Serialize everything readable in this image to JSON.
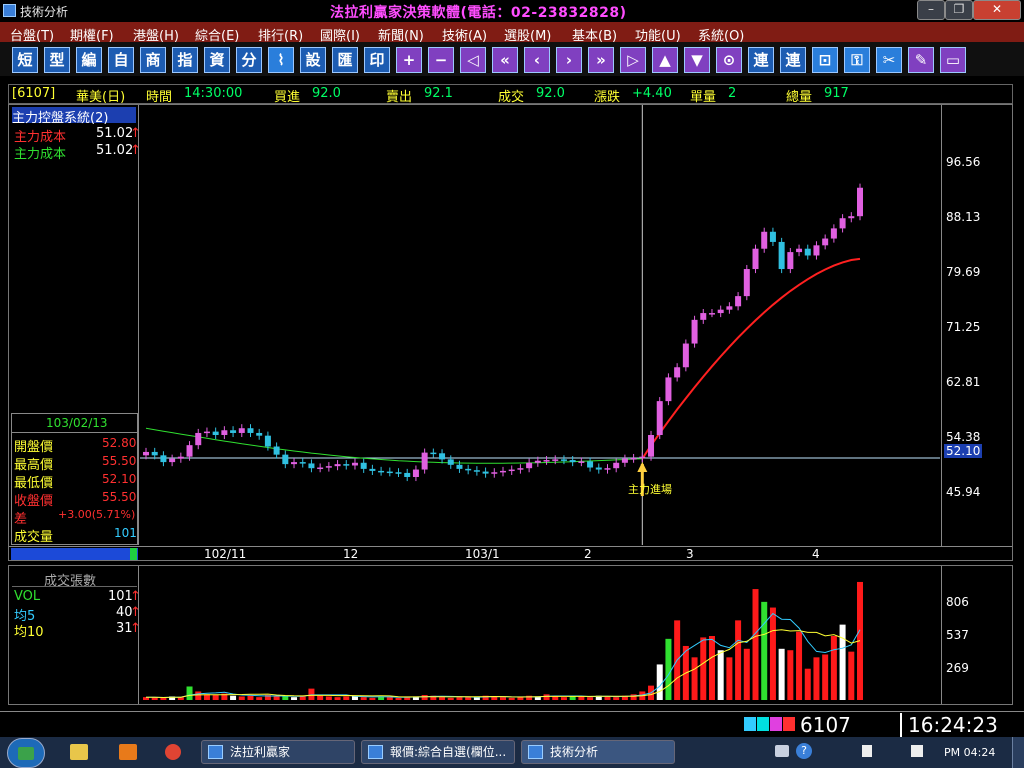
{
  "window": {
    "title": "技術分析",
    "hotline": "法拉利贏家決策軟體(電話：02-23832828)",
    "minimize": "–",
    "restore": "❐",
    "close": "✕"
  },
  "menu": [
    {
      "label": "台盤(T)"
    },
    {
      "label": "期權(F)"
    },
    {
      "label": "港盤(H)"
    },
    {
      "label": "綜合(E)"
    },
    {
      "label": "排行(R)"
    },
    {
      "label": "國際(I)"
    },
    {
      "label": "新聞(N)"
    },
    {
      "label": "技術(A)"
    },
    {
      "label": "選股(M)"
    },
    {
      "label": "基本(B)"
    },
    {
      "label": "功能(U)"
    },
    {
      "label": "系統(O)"
    }
  ],
  "toolbar": [
    {
      "label": "短",
      "icon": "short-term"
    },
    {
      "label": "型",
      "icon": "pattern"
    },
    {
      "label": "編",
      "icon": "edit"
    },
    {
      "label": "自",
      "icon": "custom"
    },
    {
      "label": "商",
      "icon": "commodity"
    },
    {
      "label": "指",
      "icon": "index"
    },
    {
      "label": "資",
      "icon": "data"
    },
    {
      "label": "分",
      "icon": "minute"
    },
    {
      "label": "⌇",
      "icon": "chart-icon"
    },
    {
      "label": "設",
      "icon": "settings"
    },
    {
      "label": "匯",
      "icon": "export"
    },
    {
      "label": "印",
      "icon": "print"
    },
    {
      "label": "+",
      "icon": "zoom-in-icon"
    },
    {
      "label": "−",
      "icon": "zoom-out-icon"
    },
    {
      "label": "◁",
      "icon": "first-icon"
    },
    {
      "label": "«",
      "icon": "rewind-icon"
    },
    {
      "label": "‹",
      "icon": "prev-icon"
    },
    {
      "label": "›",
      "icon": "next-icon"
    },
    {
      "label": "»",
      "icon": "forward-icon"
    },
    {
      "label": "▷",
      "icon": "last-icon"
    },
    {
      "label": "▲",
      "icon": "up-icon"
    },
    {
      "label": "▼",
      "icon": "down-icon"
    },
    {
      "label": "⊙",
      "icon": "esc-icon"
    },
    {
      "label": "連",
      "icon": "link"
    },
    {
      "label": "連",
      "icon": "link-2"
    },
    {
      "label": "⊡",
      "icon": "window-icon"
    },
    {
      "label": "⚿",
      "icon": "lock-icon"
    },
    {
      "label": "✂",
      "icon": "tools-icon"
    },
    {
      "label": "✎",
      "icon": "note-icon"
    },
    {
      "label": "▭",
      "icon": "screen-icon"
    }
  ],
  "quote": {
    "code": "[6107]",
    "name": "華美(日)",
    "time_label": "時間",
    "time": "14:30:00",
    "bid_label": "買進",
    "bid": "92.0",
    "ask_label": "賣出",
    "ask": "92.1",
    "last_label": "成交",
    "last": "92.0",
    "change_label": "漲跌",
    "change": "+4.40",
    "unit_label": "單量",
    "unit": "2",
    "total_label": "總量",
    "total": "917"
  },
  "indicator": {
    "name": "主力控盤系統(2)",
    "rows": [
      {
        "label": "主力成本",
        "value": "51.02",
        "arrow": "↑",
        "color": "#ff3030"
      },
      {
        "label": "主力成本",
        "value": "51.02",
        "arrow": "↑",
        "color": "#30e030"
      }
    ]
  },
  "ohlc": {
    "date": "103/02/13",
    "rows": [
      {
        "label": "開盤價",
        "value": "52.80"
      },
      {
        "label": "最高價",
        "value": "55.50"
      },
      {
        "label": "最低價",
        "value": "52.10"
      },
      {
        "label": "收盤價",
        "value": "55.50"
      },
      {
        "label": "差",
        "value": "+3.00(5.71%)"
      },
      {
        "label": "成交量",
        "value": "101"
      }
    ]
  },
  "price_axis": [
    "96.56",
    "88.13",
    "79.69",
    "71.25",
    "62.81",
    "54.38",
    "45.94"
  ],
  "price_current": "52.10",
  "date_axis": [
    "102/11",
    "12",
    "103/1",
    "2",
    "3",
    "4"
  ],
  "annotation": "主力進場",
  "volume": {
    "title": "成交張數",
    "rows": [
      {
        "label": "VOL",
        "value": "101",
        "arrow": "↑",
        "color": "#30e030"
      },
      {
        "label": "均5",
        "value": "40",
        "arrow": "↑",
        "color": "#33ccff"
      },
      {
        "label": "均10",
        "value": "31",
        "arrow": "↑",
        "color": "#ffff33"
      }
    ],
    "axis": [
      "806",
      "537",
      "269"
    ]
  },
  "chart_data": {
    "type": "candlestick",
    "ylim": [
      40,
      102
    ],
    "x_ticks": [
      "102/11",
      "12",
      "103/1",
      "2",
      "3",
      "4"
    ],
    "y_ticks": [
      96.56,
      88.13,
      79.69,
      71.25,
      62.81,
      54.38,
      45.94
    ],
    "current_price": 52.1,
    "series": [
      {
        "name": "主力成本",
        "values_start": 56.0,
        "values_end": 81.5
      },
      {
        "name": "主力成本",
        "values_start": 56.5,
        "values_end": 52.0
      }
    ],
    "closes": [
      53.0,
      52.5,
      51.5,
      52.0,
      52.3,
      54.0,
      55.8,
      56.0,
      55.5,
      56.2,
      55.8,
      56.5,
      55.8,
      55.4,
      53.8,
      52.6,
      51.2,
      51.5,
      51.3,
      50.6,
      50.7,
      50.9,
      51.2,
      51.0,
      51.4,
      50.5,
      50.2,
      50.1,
      50.0,
      49.9,
      49.3,
      50.4,
      52.9,
      52.8,
      51.9,
      51.1,
      50.5,
      50.3,
      50.1,
      49.8,
      50.0,
      50.2,
      50.4,
      50.6,
      51.4,
      51.7,
      51.8,
      51.9,
      51.8,
      51.5,
      51.6,
      50.7,
      50.4,
      50.6,
      51.4,
      52.0,
      52.1,
      52.3,
      55.5,
      60.5,
      64.0,
      65.5,
      69.0,
      72.5,
      73.5,
      73.5,
      74.0,
      74.5,
      76.0,
      80.0,
      83.0,
      85.5,
      84.0,
      80.0,
      82.5,
      83.0,
      82.0,
      83.5,
      84.5,
      86.0,
      87.5,
      87.8,
      92.0
    ],
    "volumes": [
      20,
      18,
      15,
      25,
      20,
      95,
      60,
      40,
      35,
      45,
      30,
      25,
      30,
      20,
      35,
      30,
      25,
      20,
      25,
      80,
      30,
      25,
      20,
      25,
      30,
      20,
      15,
      25,
      20,
      15,
      20,
      25,
      35,
      30,
      20,
      15,
      20,
      25,
      20,
      30,
      25,
      20,
      15,
      20,
      30,
      25,
      40,
      25,
      20,
      30,
      25,
      20,
      30,
      25,
      20,
      30,
      40,
      60,
      101,
      250,
      430,
      560,
      380,
      300,
      440,
      450,
      350,
      300,
      560,
      360,
      780,
      690,
      650,
      360,
      350,
      480,
      220,
      300,
      320,
      450,
      530,
      340,
      830
    ]
  },
  "status": {
    "code": "6107",
    "time": "16:24:23"
  },
  "taskbar": {
    "start": "Start",
    "tasks": [
      {
        "label": "法拉利贏家"
      },
      {
        "label": "報價:綜合自選(欄位..."
      },
      {
        "label": "技術分析"
      }
    ],
    "clock": "PM 04:24"
  }
}
